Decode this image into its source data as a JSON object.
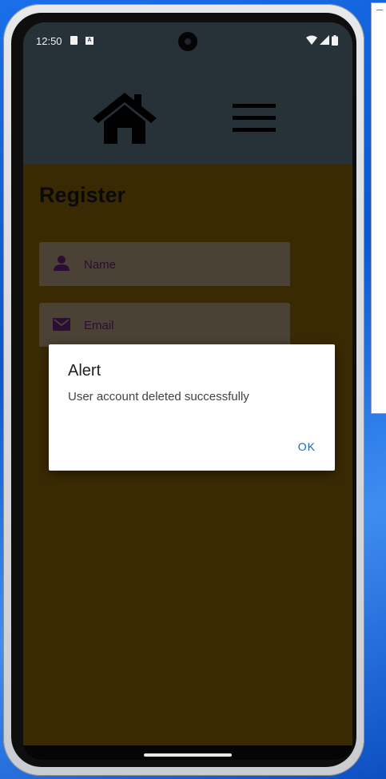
{
  "status_bar": {
    "time": "12:50",
    "sim_icon": "sd-card-icon",
    "notification_icon": "a-icon",
    "notification_letter": "A",
    "right_icons": [
      "wifi-icon",
      "signal-icon",
      "battery-icon"
    ]
  },
  "app_bar": {
    "home_icon": "home-icon",
    "menu_icon": "menu-icon"
  },
  "page": {
    "title": "Register",
    "fields": [
      {
        "icon": "person-icon",
        "placeholder": "Name"
      },
      {
        "icon": "mail-icon",
        "placeholder": "Email"
      }
    ]
  },
  "dialog": {
    "title": "Alert",
    "message": "User account deleted successfully",
    "ok_label": "OK"
  },
  "colors": {
    "app_bar": "#263238",
    "background": "#3a2a03",
    "dialog_button": "#1565c0"
  }
}
